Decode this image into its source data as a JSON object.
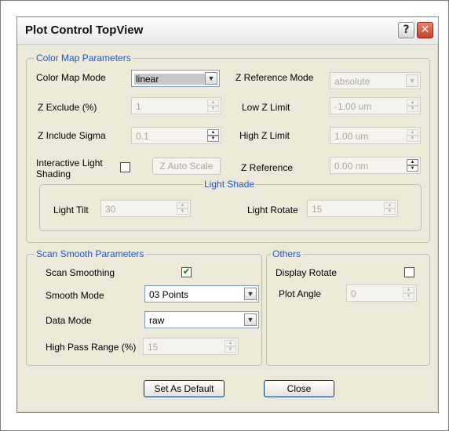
{
  "window": {
    "title": "Plot Control TopView",
    "help_button": "?",
    "close_button": "✕"
  },
  "color_map": {
    "legend": "Color Map Parameters",
    "color_map_mode_label": "Color Map Mode",
    "color_map_mode_value": "linear",
    "z_reference_mode_label": "Z Reference Mode",
    "z_reference_mode_value": "absolute",
    "z_exclude_label": "Z Exclude (%)",
    "z_exclude_value": "1",
    "low_z_limit_label": "Low Z Limit",
    "low_z_limit_value": "-1.00 um",
    "z_include_sigma_label": "Z Include Sigma",
    "z_include_sigma_value": "0.1",
    "high_z_limit_label": "High Z Limit",
    "high_z_limit_value": "1.00 um",
    "interactive_light_shading_label_1": "Interactive Light",
    "interactive_light_shading_label_2": "Shading",
    "z_auto_scale_button": "Z Auto Scale",
    "z_reference_label": "Z Reference",
    "z_reference_value": "0.00 nm"
  },
  "light_shade": {
    "legend": "Light Shade",
    "light_tilt_label": "Light Tilt",
    "light_tilt_value": "30",
    "light_rotate_label": "Light Rotate",
    "light_rotate_value": "15"
  },
  "scan_smooth": {
    "legend": "Scan Smooth Parameters",
    "scan_smoothing_label": "Scan Smoothing",
    "scan_smoothing_check": "✔",
    "smooth_mode_label": "Smooth Mode",
    "smooth_mode_value": "03 Points",
    "data_mode_label": "Data Mode",
    "data_mode_value": "raw",
    "high_pass_range_label": "High Pass Range (%)",
    "high_pass_range_value": "15"
  },
  "others": {
    "legend": "Others",
    "display_rotate_label": "Display Rotate",
    "plot_angle_label": "Plot Angle",
    "plot_angle_value": "0"
  },
  "footer": {
    "set_as_default_button": "Set As Default",
    "close_button": "Close"
  },
  "icons": {
    "dropdown_arrow": "▼",
    "spin_up": "▲",
    "spin_down": "▼"
  },
  "colors": {
    "window_bg": "#ece9d8",
    "group_legend": "#1f57c6",
    "check_mark": "#21a121",
    "close_button": "#c8402a"
  }
}
